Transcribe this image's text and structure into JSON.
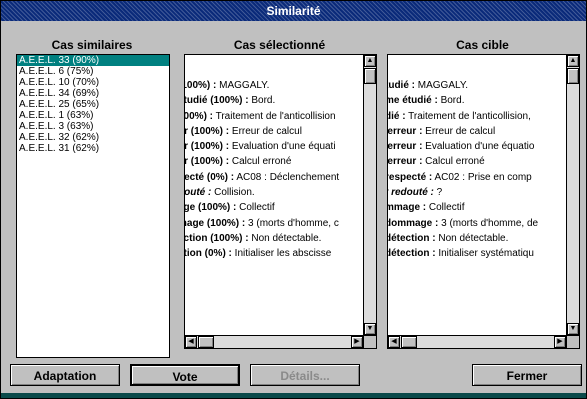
{
  "window": {
    "title": "Similarité"
  },
  "headers": {
    "similar_cases": "Cas similaires",
    "selected_case": "Cas sélectionné",
    "target_case": "Cas cible"
  },
  "similar_cases": [
    "A.E.E.L. 33 (90%)",
    "A.E.E.L. 6 (75%)",
    "A.E.E.L. 10 (70%)",
    "A.E.E.L. 34 (69%)",
    "A.E.E.L. 25 (65%)",
    "A.E.E.L. 1 (63%)",
    "A.E.E.L. 3 (63%)",
    "A.E.E.L. 32 (62%)",
    "A.E.E.L. 31 (62%)"
  ],
  "selected_index": 0,
  "selected_case_lines": [
    {
      "label": "(100%) :",
      "value": " MAGGALY.",
      "italic": false
    },
    {
      "label": "étudié (100%) :",
      "value": " Bord.",
      "italic": false
    },
    {
      "label": "100%) :",
      "value": " Traitement de l'anticollision",
      "italic": false
    },
    {
      "label": "ur (100%) :",
      "value": " Erreur de calcul",
      "italic": false
    },
    {
      "label": "ur (100%) :",
      "value": " Evaluation d'une équati",
      "italic": false
    },
    {
      "label": "ur (100%) :",
      "value": " Calcul erroné",
      "italic": false
    },
    {
      "label": "pecté (0%) :",
      "value": " AC08 : Déclenchement",
      "italic": false
    },
    {
      "label": "douté :",
      "value": " Collision.",
      "italic": true
    },
    {
      "label": "age (100%) :",
      "value": " Collectif",
      "italic": false
    },
    {
      "label": "mage (100%) :",
      "value": " 3 (morts d'homme, c",
      "italic": false
    },
    {
      "label": "ection (100%) :",
      "value": " Non détectable.",
      "italic": false
    },
    {
      "label": "ction (0%) :",
      "value": " Initialiser les abscisse",
      "italic": false
    }
  ],
  "target_case_lines": [
    {
      "label": "tudié :",
      "value": " MAGGALY.",
      "italic": false
    },
    {
      "label": "me étudié :",
      "value": " Bord.",
      "italic": false
    },
    {
      "label": "dié :",
      "value": " Traitement de l'anticollision,",
      "italic": false
    },
    {
      "label": "'erreur :",
      "value": " Erreur de calcul",
      "italic": false
    },
    {
      "label": "'erreur :",
      "value": " Evaluation d'une équatio",
      "italic": false
    },
    {
      "label": "'erreur :",
      "value": " Calcul erroné",
      "italic": false
    },
    {
      "label": "respecté :",
      "value": " AC02 : Prise en comp",
      "italic": false
    },
    {
      "label": "t redouté :",
      "value": " ?",
      "italic": true
    },
    {
      "label": "mmage :",
      "value": " Collectif",
      "italic": false
    },
    {
      "label": "dommage :",
      "value": " 3 (morts d'homme, de",
      "italic": false
    },
    {
      "label": "détection :",
      "value": " Non détectable.",
      "italic": false
    },
    {
      "label": "détection :",
      "value": " Initialiser systématiqu",
      "italic": false
    }
  ],
  "buttons": {
    "adaptation": "Adaptation",
    "vote": "Vote",
    "details": "Détails...",
    "close": "Fermer"
  },
  "colors": {
    "titlebar": "#0a2a7a",
    "selection": "#008080"
  },
  "icons": {
    "scroll_up": "▲",
    "scroll_down": "▼",
    "scroll_left": "◀",
    "scroll_right": "▶"
  }
}
